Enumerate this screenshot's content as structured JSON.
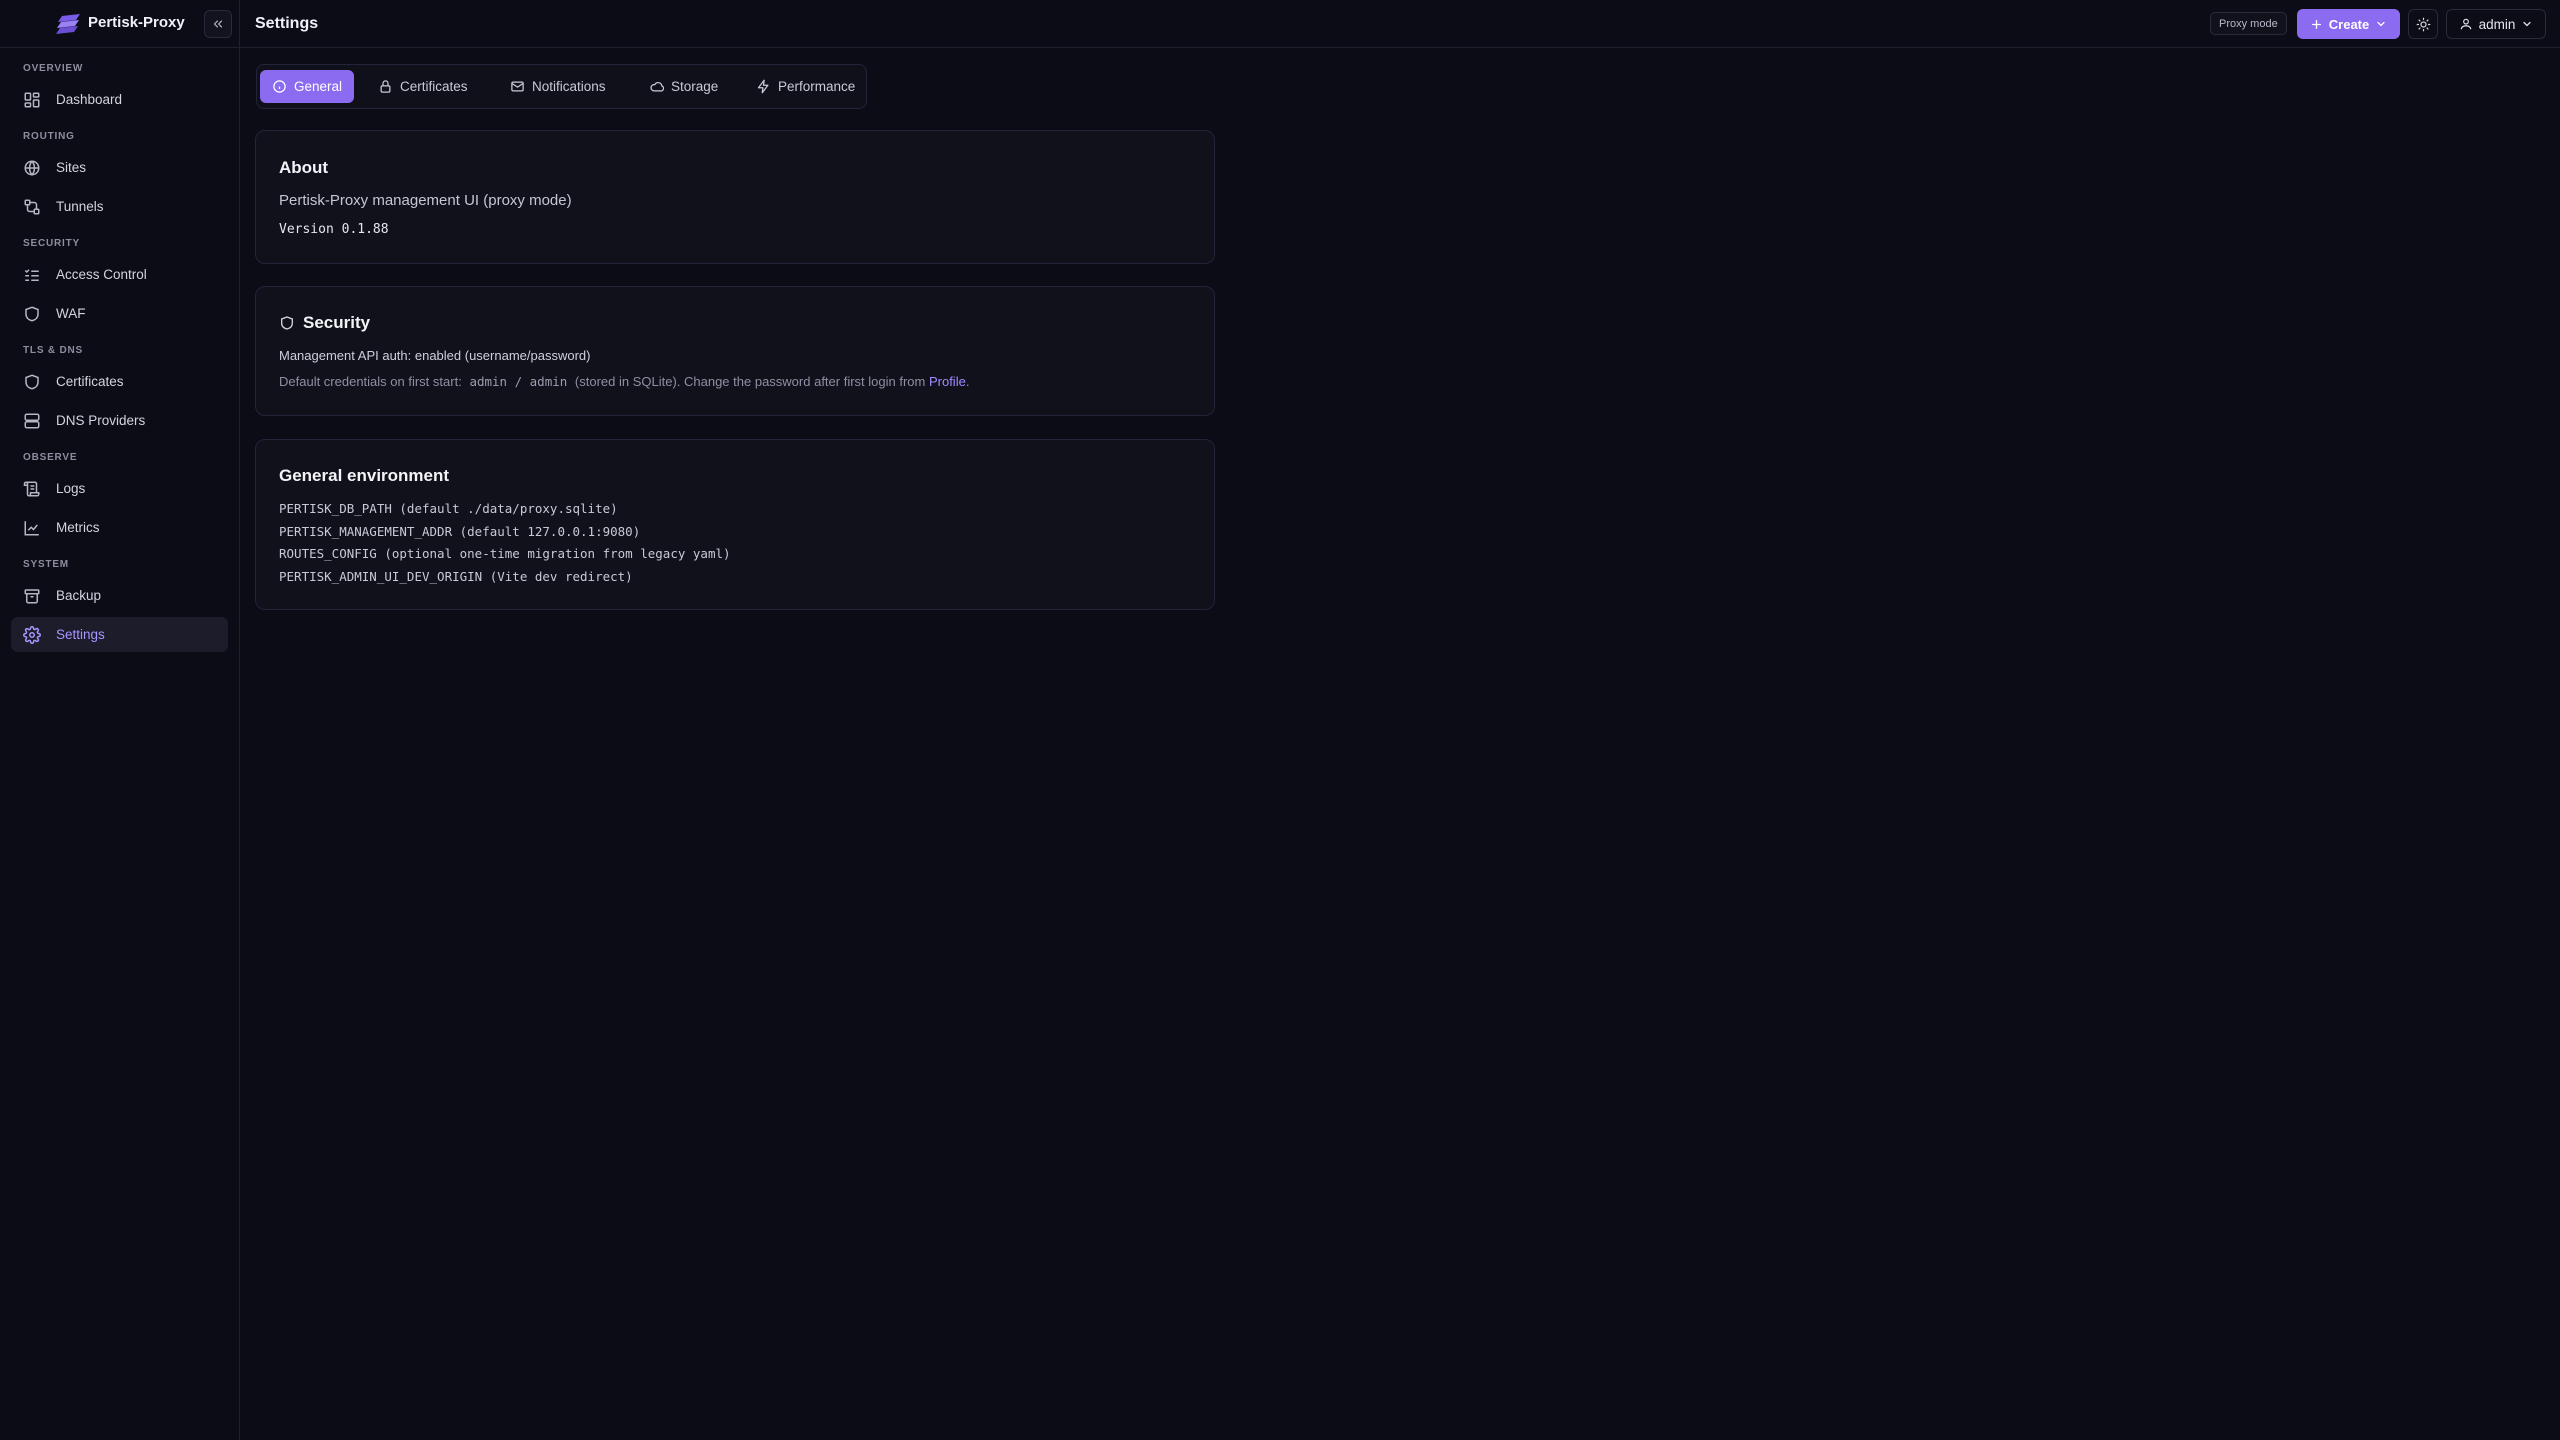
{
  "app": {
    "name": "Pertisk-Proxy",
    "page_title": "Settings"
  },
  "sidebar": {
    "sections": [
      {
        "title": "OVERVIEW",
        "items": [
          {
            "label": "Dashboard",
            "icon": "dashboard-icon"
          }
        ]
      },
      {
        "title": "ROUTING",
        "items": [
          {
            "label": "Sites",
            "icon": "globe-icon"
          },
          {
            "label": "Tunnels",
            "icon": "tunnel-icon"
          }
        ]
      },
      {
        "title": "SECURITY",
        "items": [
          {
            "label": "Access Control",
            "icon": "list-check-icon"
          },
          {
            "label": "WAF",
            "icon": "shield-icon"
          }
        ]
      },
      {
        "title": "TLS & DNS",
        "items": [
          {
            "label": "Certificates",
            "icon": "shield-icon"
          },
          {
            "label": "DNS Providers",
            "icon": "server-icon"
          }
        ]
      },
      {
        "title": "OBSERVE",
        "items": [
          {
            "label": "Logs",
            "icon": "scroll-icon"
          },
          {
            "label": "Metrics",
            "icon": "chart-line-icon"
          }
        ]
      },
      {
        "title": "SYSTEM",
        "items": [
          {
            "label": "Backup",
            "icon": "archive-icon"
          },
          {
            "label": "Settings",
            "icon": "gear-icon",
            "active": true
          }
        ]
      }
    ]
  },
  "topbar": {
    "proxy_mode": "Proxy mode",
    "create_label": "Create",
    "user_label": "admin"
  },
  "tabs": [
    {
      "label": "General",
      "icon": "info-icon",
      "active": true
    },
    {
      "label": "Certificates",
      "icon": "lock-icon"
    },
    {
      "label": "Notifications",
      "icon": "mail-icon"
    },
    {
      "label": "Storage",
      "icon": "cloud-icon"
    },
    {
      "label": "Performance",
      "icon": "bolt-icon"
    }
  ],
  "about": {
    "title": "About",
    "description": "Pertisk-Proxy management UI (proxy mode)",
    "version": "Version 0.1.88"
  },
  "security": {
    "title": "Security",
    "auth_line": "Management API auth: enabled (username/password)",
    "creds_prefix": "Default credentials on first start:",
    "creds_value": "admin / admin",
    "creds_suffix": "(stored in SQLite). Change the password after first login from",
    "profile_link": "Profile",
    "period": "."
  },
  "environment": {
    "title": "General environment",
    "lines": [
      "PERTISK_DB_PATH (default ./data/proxy.sqlite)",
      "PERTISK_MANAGEMENT_ADDR (default 127.0.0.1:9080)",
      "ROUTES_CONFIG (optional one-time migration from legacy yaml)",
      "PERTISK_ADMIN_UI_DEV_ORIGIN (Vite dev redirect)"
    ]
  },
  "colors": {
    "accent": "#8b6cf0",
    "background": "#0c0c16",
    "card": "#11111c"
  }
}
